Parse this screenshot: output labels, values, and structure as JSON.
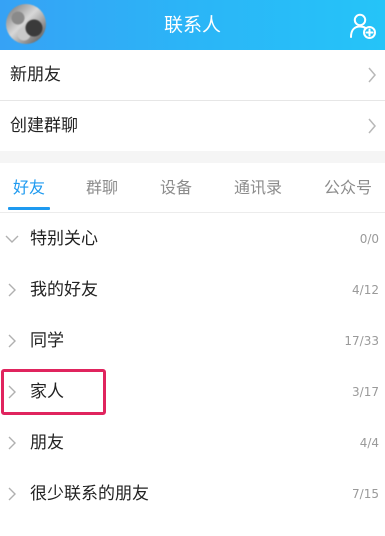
{
  "header": {
    "title": "联系人",
    "add_icon": "add-contact-icon",
    "accent": "#2bb5f7"
  },
  "menu": [
    {
      "label": "新朋友"
    },
    {
      "label": "创建群聊"
    }
  ],
  "tabs": [
    {
      "label": "好友",
      "active": true
    },
    {
      "label": "群聊"
    },
    {
      "label": "设备"
    },
    {
      "label": "通讯录"
    },
    {
      "label": "公众号"
    }
  ],
  "groups": [
    {
      "name": "特别关心",
      "count": "0/0",
      "expanded": true
    },
    {
      "name": "我的好友",
      "count": "4/12"
    },
    {
      "name": "同学",
      "count": "17/33"
    },
    {
      "name": "家人",
      "count": "3/17",
      "highlighted": true
    },
    {
      "name": "朋友",
      "count": "4/4"
    },
    {
      "name": "很少联系的朋友",
      "count": "7/15"
    }
  ],
  "colors": {
    "tab_active": "#1e9af0",
    "highlight_box": "#e0245e"
  }
}
